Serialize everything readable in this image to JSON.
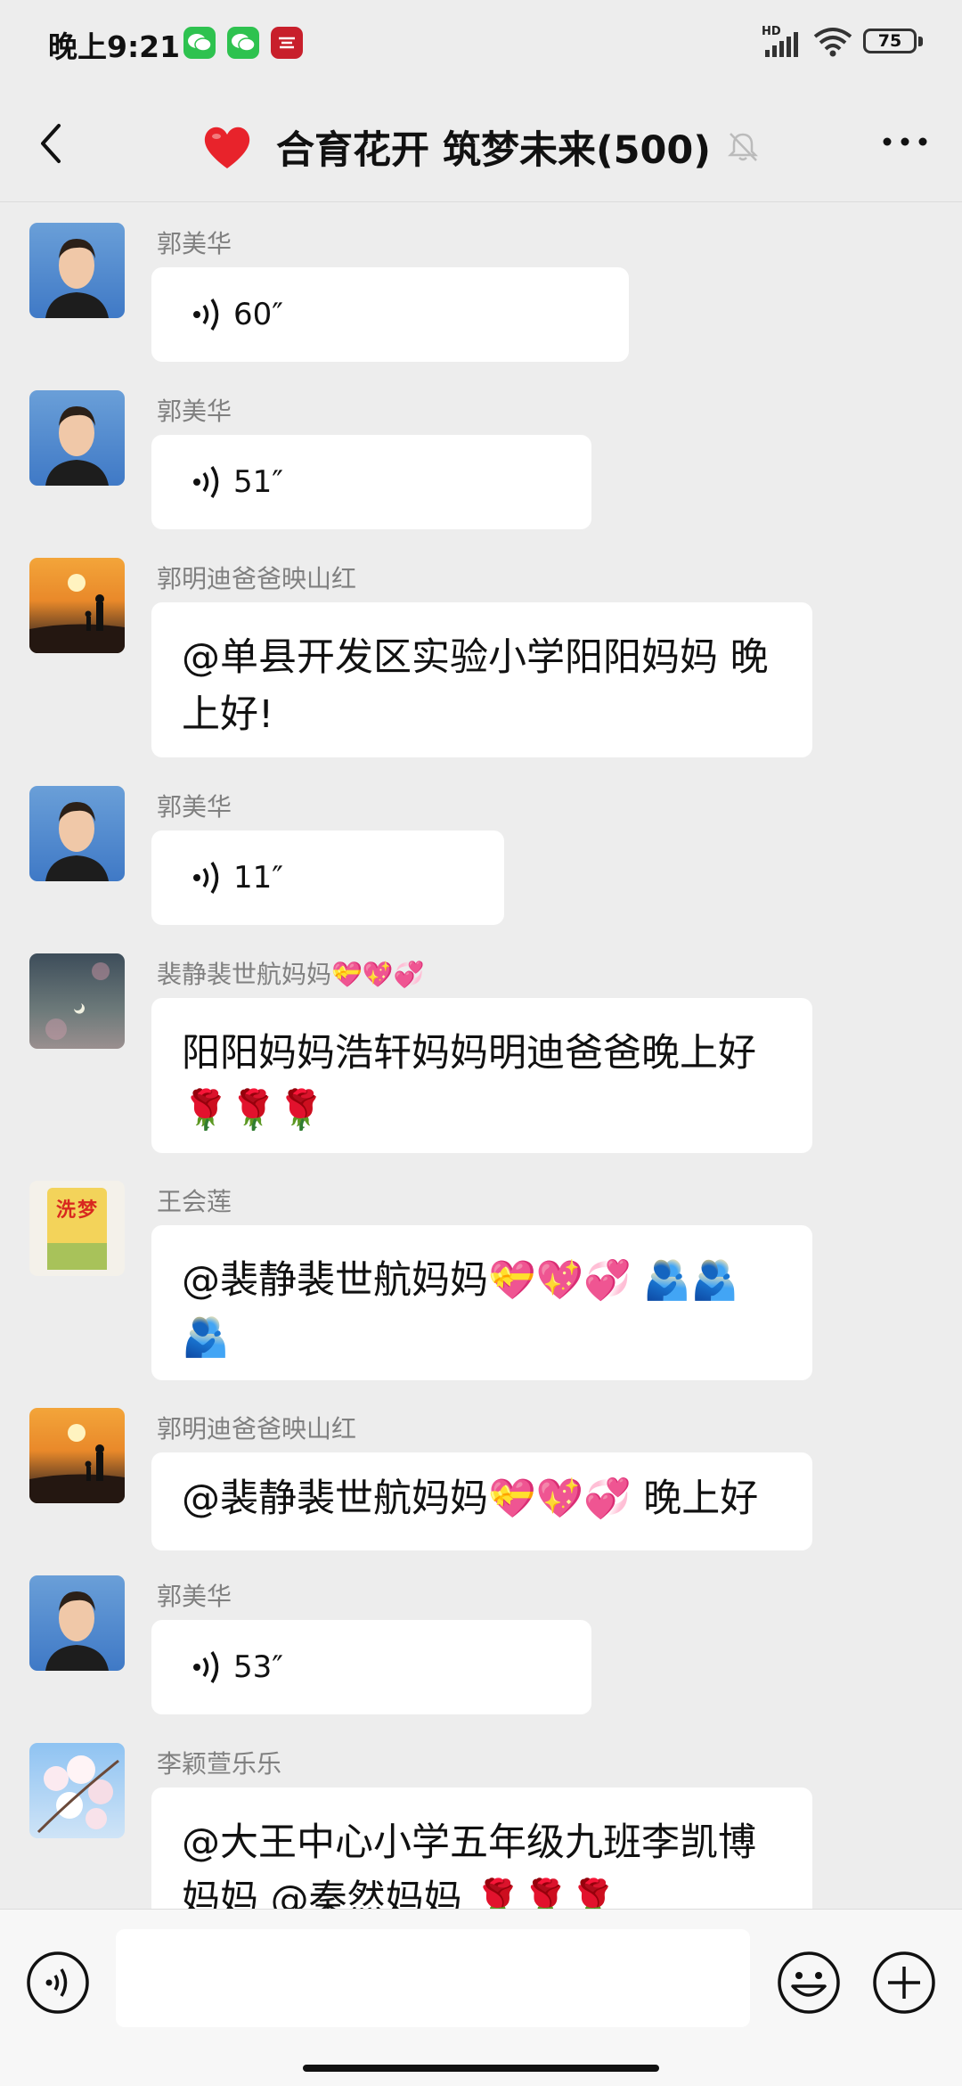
{
  "status_bar": {
    "time": "晚上9:21",
    "hd": "HD",
    "battery": "75",
    "app_icons": [
      "wechat-icon",
      "wechat-icon",
      "red-app-icon"
    ]
  },
  "header": {
    "title": "合育花开 筑梦未来(500)",
    "icons": [
      "back-icon",
      "heart-icon",
      "mute-icon",
      "more-icon"
    ]
  },
  "messages": [
    {
      "sender": "郭美华",
      "type": "voice",
      "duration": "60″"
    },
    {
      "sender": "郭美华",
      "type": "voice",
      "duration": "51″"
    },
    {
      "sender": "郭明迪爸爸映山红",
      "type": "text",
      "text": "@单县开发区实验小学阳阳妈妈 晚上好!"
    },
    {
      "sender": "郭美华",
      "type": "voice",
      "duration": "11″"
    },
    {
      "sender": "裴静裴世航妈妈💝💖💞",
      "type": "text",
      "text": "阳阳妈妈浩轩妈妈明迪爸爸晚上好🌹🌹🌹"
    },
    {
      "sender": "王会莲",
      "type": "text",
      "text": "@裴静裴世航妈妈💝💖💞 🫂🫂🫂"
    },
    {
      "sender": "郭明迪爸爸映山红",
      "type": "text",
      "text": "@裴静裴世航妈妈💝💖💞 晚上好"
    },
    {
      "sender": "郭美华",
      "type": "voice",
      "duration": "53″"
    },
    {
      "sender": "李颖萱乐乐",
      "type": "text",
      "text": "@大王中心小学五年级九班李凯博妈妈 @秦然妈妈 🌹🌹🌹"
    }
  ],
  "input": {
    "placeholder": ""
  },
  "colors": {
    "background": "#ededed",
    "bubble": "#ffffff",
    "sender": "#808080"
  }
}
